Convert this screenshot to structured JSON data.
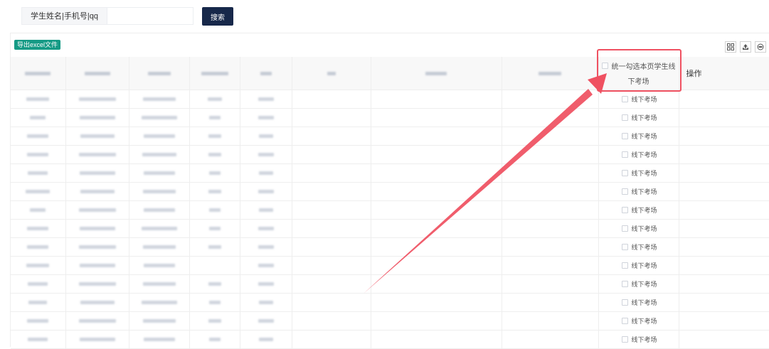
{
  "search": {
    "label": "学生姓名|手机号|qq",
    "value": "",
    "button_label": "搜索"
  },
  "toolbar": {
    "export_label": "导出excel文件",
    "icons": [
      "column-filter-icon",
      "export-icon",
      "print-icon"
    ]
  },
  "table": {
    "header_checkbox_line1": "统一勾选本页学生线",
    "header_checkbox_line2": "下考场",
    "operation_label": "操作",
    "row_checkbox_label": "线下考场",
    "row_count": 14
  },
  "colors": {
    "primary_button": "#17284a",
    "export_button": "#159a85",
    "annotation": "#ef5161"
  }
}
